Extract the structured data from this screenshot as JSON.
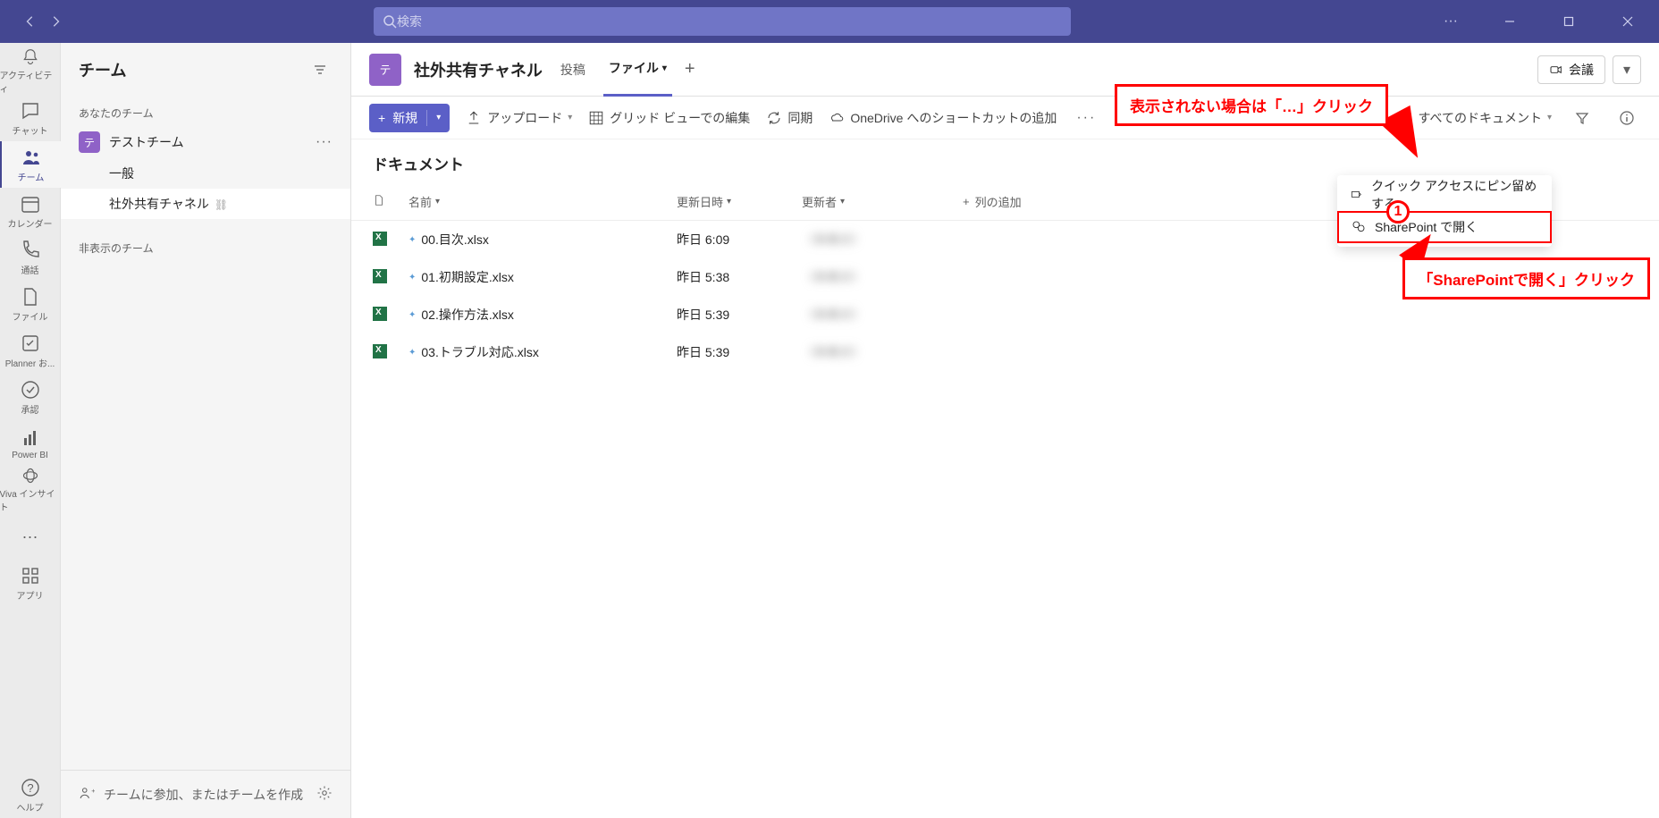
{
  "search": {
    "placeholder": "検索"
  },
  "apprail": [
    {
      "id": "activity",
      "label": "アクティビティ"
    },
    {
      "id": "chat",
      "label": "チャット"
    },
    {
      "id": "teams",
      "label": "チーム"
    },
    {
      "id": "calendar",
      "label": "カレンダー"
    },
    {
      "id": "calls",
      "label": "通話"
    },
    {
      "id": "files",
      "label": "ファイル"
    },
    {
      "id": "planner",
      "label": "Planner お..."
    },
    {
      "id": "approve",
      "label": "承認"
    },
    {
      "id": "powerbi",
      "label": "Power BI"
    },
    {
      "id": "viva",
      "label": "Viva インサイト"
    }
  ],
  "apprail_bottom": {
    "apps": "アプリ",
    "help": "ヘルプ"
  },
  "sidebar": {
    "title": "チーム",
    "your_teams_label": "あなたのチーム",
    "team": {
      "initial": "テ",
      "name": "テストチーム"
    },
    "channels": [
      {
        "name": "一般"
      },
      {
        "name": "社外共有チャネル",
        "shared": true
      }
    ],
    "hidden_label": "非表示のチーム",
    "footer_text": "チームに参加、またはチームを作成"
  },
  "channel_header": {
    "initial": "テ",
    "title": "社外共有チャネル",
    "tabs": {
      "posts": "投稿",
      "files": "ファイル"
    },
    "meet": "会議"
  },
  "toolbar": {
    "new": "新規",
    "upload": "アップロード",
    "grid_edit": "グリッド ビューでの編集",
    "sync": "同期",
    "onedrive": "OneDrive へのショートカットの追加",
    "view": "すべてのドキュメント"
  },
  "doc": {
    "heading": "ドキュメント",
    "columns": {
      "name": "名前",
      "modified": "更新日時",
      "modified_by": "更新者",
      "add": "列の追加"
    },
    "rows": [
      {
        "name": "00.目次.xlsx",
        "date": "昨日 6:09",
        "by": "（非表示）"
      },
      {
        "name": "01.初期設定.xlsx",
        "date": "昨日 5:38",
        "by": "（非表示）"
      },
      {
        "name": "02.操作方法.xlsx",
        "date": "昨日 5:39",
        "by": "（非表示）"
      },
      {
        "name": "03.トラブル対応.xlsx",
        "date": "昨日 5:39",
        "by": "（非表示）"
      }
    ]
  },
  "context_menu": {
    "pin": "クイック アクセスにピン留めする",
    "open_sp": "SharePoint で開く"
  },
  "callouts": {
    "c1": "表示されない場合は「…」クリック",
    "c2": "「SharePointで開く」クリック",
    "badge": "1"
  }
}
